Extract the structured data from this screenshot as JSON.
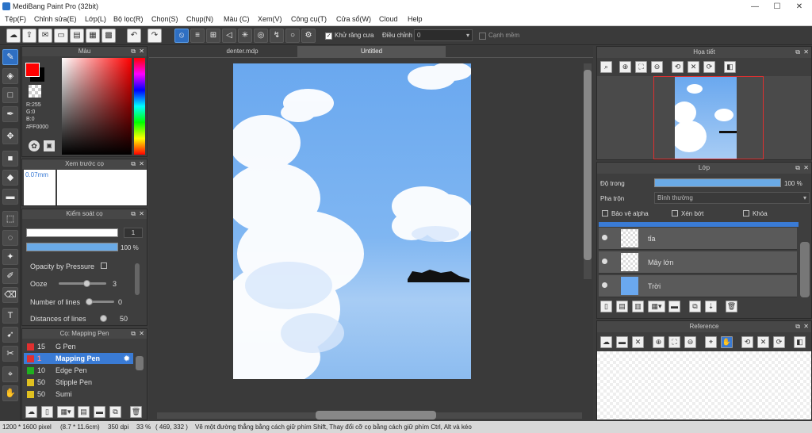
{
  "window": {
    "title": "MediBang Paint Pro (32bit)",
    "minimize": "—",
    "maximize": "☐",
    "close": "✕"
  },
  "menu": [
    "Tệp(F)",
    "Chỉnh sửa(E)",
    "Lớp(L)",
    "Bộ lọc(R)",
    "Chọn(S)",
    "Chụp(N)",
    "Màu (C)",
    "Xem(V)",
    "Công cụ(T)",
    "Cửa sổ(W)",
    "Cloud",
    "Help"
  ],
  "toolbar": {
    "antialias_label": "Khử răng cưa",
    "adjust_label": "Điều chỉnh",
    "adjust_value": "0",
    "edge_label": "Cạnh mềm"
  },
  "color_panel": {
    "title": "Màu",
    "r": "R:255",
    "g": "G:0",
    "b": "B:0",
    "hex": "#FF0000",
    "primary": "#ff0000"
  },
  "preview_panel": {
    "title": "Xem trước cọ",
    "size": "0.07mm"
  },
  "brush_control": {
    "title": "Kiểm soát cọ",
    "size_value": "1",
    "opacity_value": "100 %",
    "opacity_pressure": "Opacity by Pressure",
    "ooze_label": "Ooze",
    "ooze_value": "3",
    "lines_label": "Number of lines",
    "lines_value": "0",
    "distance_label": "Distances of lines",
    "distance_value": "50"
  },
  "brush_list": {
    "title": "Cọ: Mapping Pen",
    "items": [
      {
        "size": "15",
        "name": "G Pen",
        "color": "#e03030"
      },
      {
        "size": "1",
        "name": "Mapping Pen",
        "color": "#e03030",
        "selected": true
      },
      {
        "size": "10",
        "name": "Edge Pen",
        "color": "#20b020"
      },
      {
        "size": "50",
        "name": "Stipple Pen",
        "color": "#e0c020"
      },
      {
        "size": "50",
        "name": "Sumi",
        "color": "#e0c020"
      }
    ]
  },
  "tabs": [
    "denter.mdp",
    "Untitled"
  ],
  "navigator": {
    "title": "Họa tiết"
  },
  "layer_panel": {
    "title": "Lớp",
    "opacity_label": "Độ trong",
    "opacity_value": "100 %",
    "blend_label": "Pha trộn",
    "blend_value": "Bình thường",
    "protect_alpha": "Bảo vệ alpha",
    "clipping": "Xén bớt",
    "lock": "Khóa",
    "layers": [
      {
        "name": "tỉa"
      },
      {
        "name": "Mây lớn"
      },
      {
        "name": "Trời"
      }
    ]
  },
  "reference_panel": {
    "title": "Reference"
  },
  "status": {
    "size": "1200 * 1600 pixel",
    "cm": "(8.7 * 11.6cm)",
    "dpi": "350 dpi",
    "zoom": "33 %",
    "coords": "( 469, 332 )",
    "hint": "Vẽ một đường thẳng bằng cách giữ phím Shift, Thay đổi cỡ cọ bằng cách giữ phím Ctrl, Alt và kéo"
  }
}
